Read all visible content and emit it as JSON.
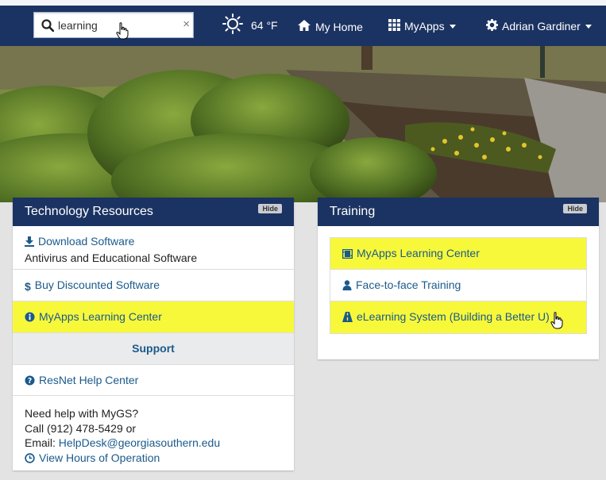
{
  "search": {
    "value": "learning",
    "clear": "×"
  },
  "weather": {
    "temp": "64 °F"
  },
  "nav": {
    "home": "My Home",
    "apps": "MyApps",
    "user": "Adrian Gardiner"
  },
  "tech": {
    "title": "Technology Resources",
    "hide": "Hide",
    "download": {
      "label": "Download Software",
      "desc": "Antivirus and Educational Software"
    },
    "buy": "Buy Discounted Software",
    "learning": "MyApps Learning Center",
    "support": "Support",
    "resnet": "ResNet Help Center",
    "help": {
      "line1": "Need help with MyGS?",
      "line2": "Call (912) 478-5429 or",
      "email_label": "Email: ",
      "email": "HelpDesk@georgiasouthern.edu",
      "hours": "View Hours of Operation"
    }
  },
  "training": {
    "title": "Training",
    "hide": "Hide",
    "items": [
      "MyApps Learning Center",
      "Face-to-face Training",
      "eLearning System (Building a Better U)"
    ]
  },
  "colors": {
    "nav": "#1b3362",
    "highlight": "#f8f83a",
    "link": "#1a5a8c"
  }
}
